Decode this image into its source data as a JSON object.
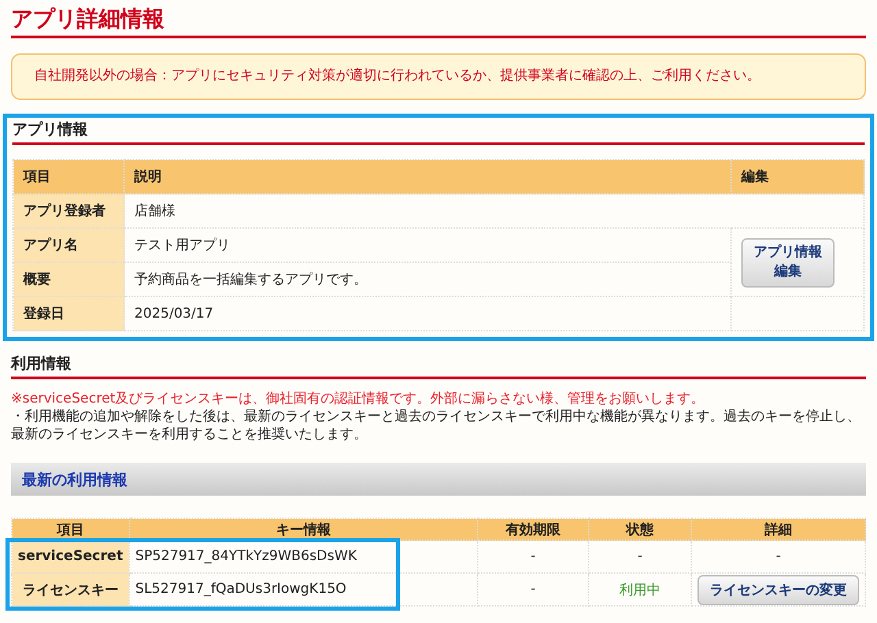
{
  "page_title": "アプリ詳細情報",
  "notice": "自社開発以外の場合：アプリにセキュリティ対策が適切に行われているか、提供事業者に確認の上、ご利用ください。",
  "app_info": {
    "heading": "アプリ情報",
    "highlighted": true,
    "columns": [
      "項目",
      "説明",
      "編集"
    ],
    "rows": [
      {
        "label": "アプリ登録者",
        "value": "店舗様"
      },
      {
        "label": "アプリ名",
        "value": "テスト用アプリ"
      },
      {
        "label": "概要",
        "value": "予約商品を一括編集するアプリです。"
      },
      {
        "label": "登録日",
        "value": "2025/03/17"
      }
    ],
    "edit_button": [
      "アプリ情報",
      "編集"
    ]
  },
  "usage_info": {
    "heading": "利用情報",
    "warning": "※serviceSecret及びライセンスキーは、御社固有の認証情報です。外部に漏らさない様、管理をお願いします。",
    "note": "・利用機能の追加や解除をした後は、最新のライセンスキーと過去のライセンスキーで利用中な機能が異なります。過去のキーを停止し、最新のライセンスキーを利用することを推奨いたします。",
    "subheading": "最新の利用情報",
    "keys_highlighted": true,
    "columns": [
      "項目",
      "キー情報",
      "有効期限",
      "状態",
      "詳細"
    ],
    "rows": [
      {
        "label": "serviceSecret",
        "key": "SP527917_84YTkYz9WB6sDsWK",
        "expiry": "-",
        "status": "-",
        "kind": "plain",
        "detail": {
          "kind": "text",
          "text": "-"
        }
      },
      {
        "label": "ライセンスキー",
        "key": "SL527917_fQaDUs3rIowgK15O",
        "expiry": "-",
        "status": "利用中",
        "kind": "active",
        "detail": {
          "kind": "button",
          "text": "ライセンスキーの変更"
        }
      }
    ]
  }
}
